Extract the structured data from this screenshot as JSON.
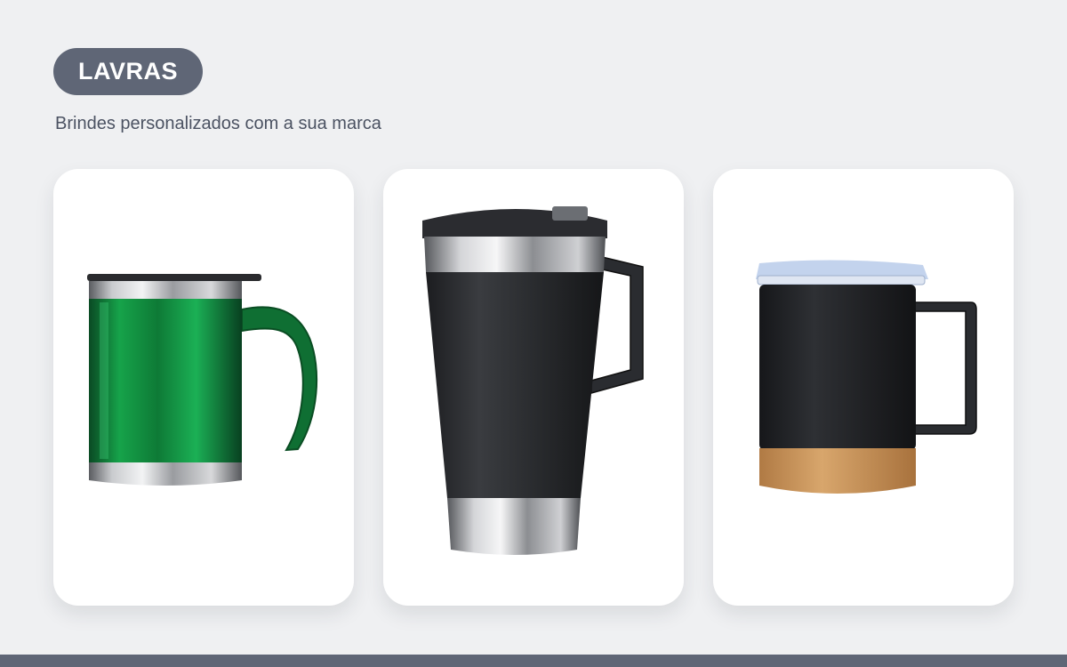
{
  "brand": {
    "name": "LAVRAS",
    "tagline": "Brindes personalizados com a sua marca"
  },
  "colors": {
    "background": "#eff0f2",
    "badge": "#5f6676",
    "card": "#ffffff",
    "footer": "#5f6676"
  },
  "products": [
    {
      "image": "green-acrylic-steel-mug-image"
    },
    {
      "image": "black-steel-pint-tumbler-image"
    },
    {
      "image": "black-cork-base-mug-image"
    }
  ]
}
